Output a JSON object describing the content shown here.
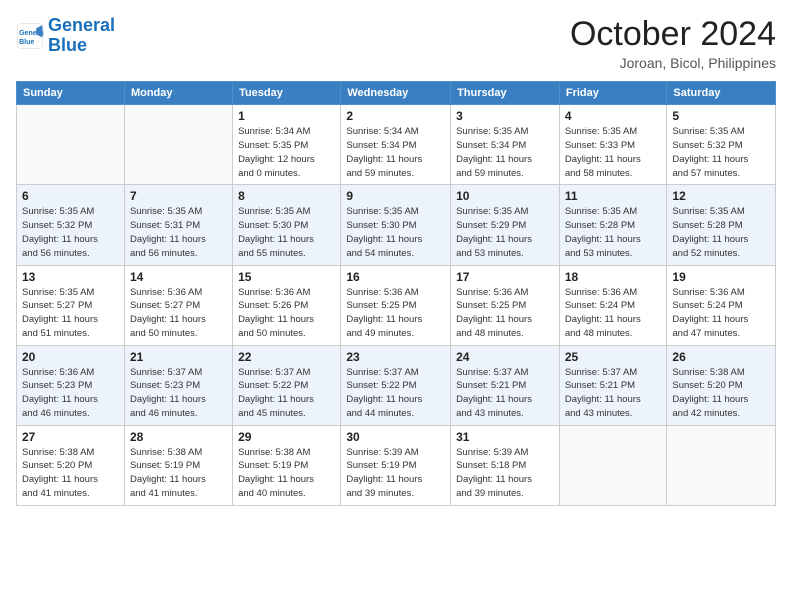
{
  "header": {
    "logo_line1": "General",
    "logo_line2": "Blue",
    "month": "October 2024",
    "location": "Joroan, Bicol, Philippines"
  },
  "columns": [
    "Sunday",
    "Monday",
    "Tuesday",
    "Wednesday",
    "Thursday",
    "Friday",
    "Saturday"
  ],
  "weeks": [
    [
      {
        "day": "",
        "info": ""
      },
      {
        "day": "",
        "info": ""
      },
      {
        "day": "1",
        "info": "Sunrise: 5:34 AM\nSunset: 5:35 PM\nDaylight: 12 hours\nand 0 minutes."
      },
      {
        "day": "2",
        "info": "Sunrise: 5:34 AM\nSunset: 5:34 PM\nDaylight: 11 hours\nand 59 minutes."
      },
      {
        "day": "3",
        "info": "Sunrise: 5:35 AM\nSunset: 5:34 PM\nDaylight: 11 hours\nand 59 minutes."
      },
      {
        "day": "4",
        "info": "Sunrise: 5:35 AM\nSunset: 5:33 PM\nDaylight: 11 hours\nand 58 minutes."
      },
      {
        "day": "5",
        "info": "Sunrise: 5:35 AM\nSunset: 5:32 PM\nDaylight: 11 hours\nand 57 minutes."
      }
    ],
    [
      {
        "day": "6",
        "info": "Sunrise: 5:35 AM\nSunset: 5:32 PM\nDaylight: 11 hours\nand 56 minutes."
      },
      {
        "day": "7",
        "info": "Sunrise: 5:35 AM\nSunset: 5:31 PM\nDaylight: 11 hours\nand 56 minutes."
      },
      {
        "day": "8",
        "info": "Sunrise: 5:35 AM\nSunset: 5:30 PM\nDaylight: 11 hours\nand 55 minutes."
      },
      {
        "day": "9",
        "info": "Sunrise: 5:35 AM\nSunset: 5:30 PM\nDaylight: 11 hours\nand 54 minutes."
      },
      {
        "day": "10",
        "info": "Sunrise: 5:35 AM\nSunset: 5:29 PM\nDaylight: 11 hours\nand 53 minutes."
      },
      {
        "day": "11",
        "info": "Sunrise: 5:35 AM\nSunset: 5:28 PM\nDaylight: 11 hours\nand 53 minutes."
      },
      {
        "day": "12",
        "info": "Sunrise: 5:35 AM\nSunset: 5:28 PM\nDaylight: 11 hours\nand 52 minutes."
      }
    ],
    [
      {
        "day": "13",
        "info": "Sunrise: 5:35 AM\nSunset: 5:27 PM\nDaylight: 11 hours\nand 51 minutes."
      },
      {
        "day": "14",
        "info": "Sunrise: 5:36 AM\nSunset: 5:27 PM\nDaylight: 11 hours\nand 50 minutes."
      },
      {
        "day": "15",
        "info": "Sunrise: 5:36 AM\nSunset: 5:26 PM\nDaylight: 11 hours\nand 50 minutes."
      },
      {
        "day": "16",
        "info": "Sunrise: 5:36 AM\nSunset: 5:25 PM\nDaylight: 11 hours\nand 49 minutes."
      },
      {
        "day": "17",
        "info": "Sunrise: 5:36 AM\nSunset: 5:25 PM\nDaylight: 11 hours\nand 48 minutes."
      },
      {
        "day": "18",
        "info": "Sunrise: 5:36 AM\nSunset: 5:24 PM\nDaylight: 11 hours\nand 48 minutes."
      },
      {
        "day": "19",
        "info": "Sunrise: 5:36 AM\nSunset: 5:24 PM\nDaylight: 11 hours\nand 47 minutes."
      }
    ],
    [
      {
        "day": "20",
        "info": "Sunrise: 5:36 AM\nSunset: 5:23 PM\nDaylight: 11 hours\nand 46 minutes."
      },
      {
        "day": "21",
        "info": "Sunrise: 5:37 AM\nSunset: 5:23 PM\nDaylight: 11 hours\nand 46 minutes."
      },
      {
        "day": "22",
        "info": "Sunrise: 5:37 AM\nSunset: 5:22 PM\nDaylight: 11 hours\nand 45 minutes."
      },
      {
        "day": "23",
        "info": "Sunrise: 5:37 AM\nSunset: 5:22 PM\nDaylight: 11 hours\nand 44 minutes."
      },
      {
        "day": "24",
        "info": "Sunrise: 5:37 AM\nSunset: 5:21 PM\nDaylight: 11 hours\nand 43 minutes."
      },
      {
        "day": "25",
        "info": "Sunrise: 5:37 AM\nSunset: 5:21 PM\nDaylight: 11 hours\nand 43 minutes."
      },
      {
        "day": "26",
        "info": "Sunrise: 5:38 AM\nSunset: 5:20 PM\nDaylight: 11 hours\nand 42 minutes."
      }
    ],
    [
      {
        "day": "27",
        "info": "Sunrise: 5:38 AM\nSunset: 5:20 PM\nDaylight: 11 hours\nand 41 minutes."
      },
      {
        "day": "28",
        "info": "Sunrise: 5:38 AM\nSunset: 5:19 PM\nDaylight: 11 hours\nand 41 minutes."
      },
      {
        "day": "29",
        "info": "Sunrise: 5:38 AM\nSunset: 5:19 PM\nDaylight: 11 hours\nand 40 minutes."
      },
      {
        "day": "30",
        "info": "Sunrise: 5:39 AM\nSunset: 5:19 PM\nDaylight: 11 hours\nand 39 minutes."
      },
      {
        "day": "31",
        "info": "Sunrise: 5:39 AM\nSunset: 5:18 PM\nDaylight: 11 hours\nand 39 minutes."
      },
      {
        "day": "",
        "info": ""
      },
      {
        "day": "",
        "info": ""
      }
    ]
  ]
}
